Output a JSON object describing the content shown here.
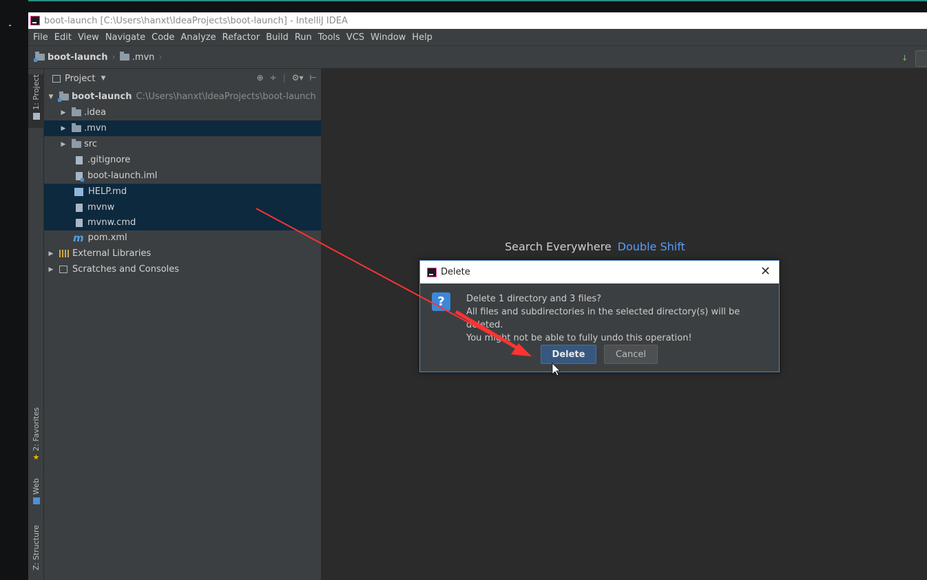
{
  "window": {
    "title": "boot-launch [C:\\Users\\hanxt\\IdeaProjects\\boot-launch] - IntelliJ IDEA"
  },
  "menu": [
    "File",
    "Edit",
    "View",
    "Navigate",
    "Code",
    "Analyze",
    "Refactor",
    "Build",
    "Run",
    "Tools",
    "VCS",
    "Window",
    "Help"
  ],
  "breadcrumb": [
    "boot-launch",
    ".mvn"
  ],
  "side_tabs": {
    "project": "1: Project",
    "favorites": "2: Favorites",
    "web": "Web",
    "structure": "Z: Structure"
  },
  "project_panel": {
    "title": "Project",
    "root": {
      "name": "boot-launch",
      "path": "C:\\Users\\hanxt\\IdeaProjects\\boot-launch"
    },
    "items": [
      ".idea",
      ".mvn",
      "src",
      ".gitignore",
      "boot-launch.iml",
      "HELP.md",
      "mvnw",
      "mvnw.cmd",
      "pom.xml"
    ],
    "external_libraries": "External Libraries",
    "scratches": "Scratches and Consoles"
  },
  "editor": {
    "hint_label": "Search Everywhere",
    "hint_key": "Double Shift"
  },
  "dialog": {
    "title": "Delete",
    "line1": "Delete 1 directory and 3 files?",
    "line2": "All files and subdirectories in the selected directory(s) will be deleted.",
    "line3": "You might not be able to fully undo this operation!",
    "delete_label": "Delete",
    "cancel_label": "Cancel"
  },
  "colors": {
    "accent": "#4a88c7",
    "selection": "#0d293e",
    "annotation_arrow": "#ff3333",
    "hint_key": "#589df6"
  }
}
